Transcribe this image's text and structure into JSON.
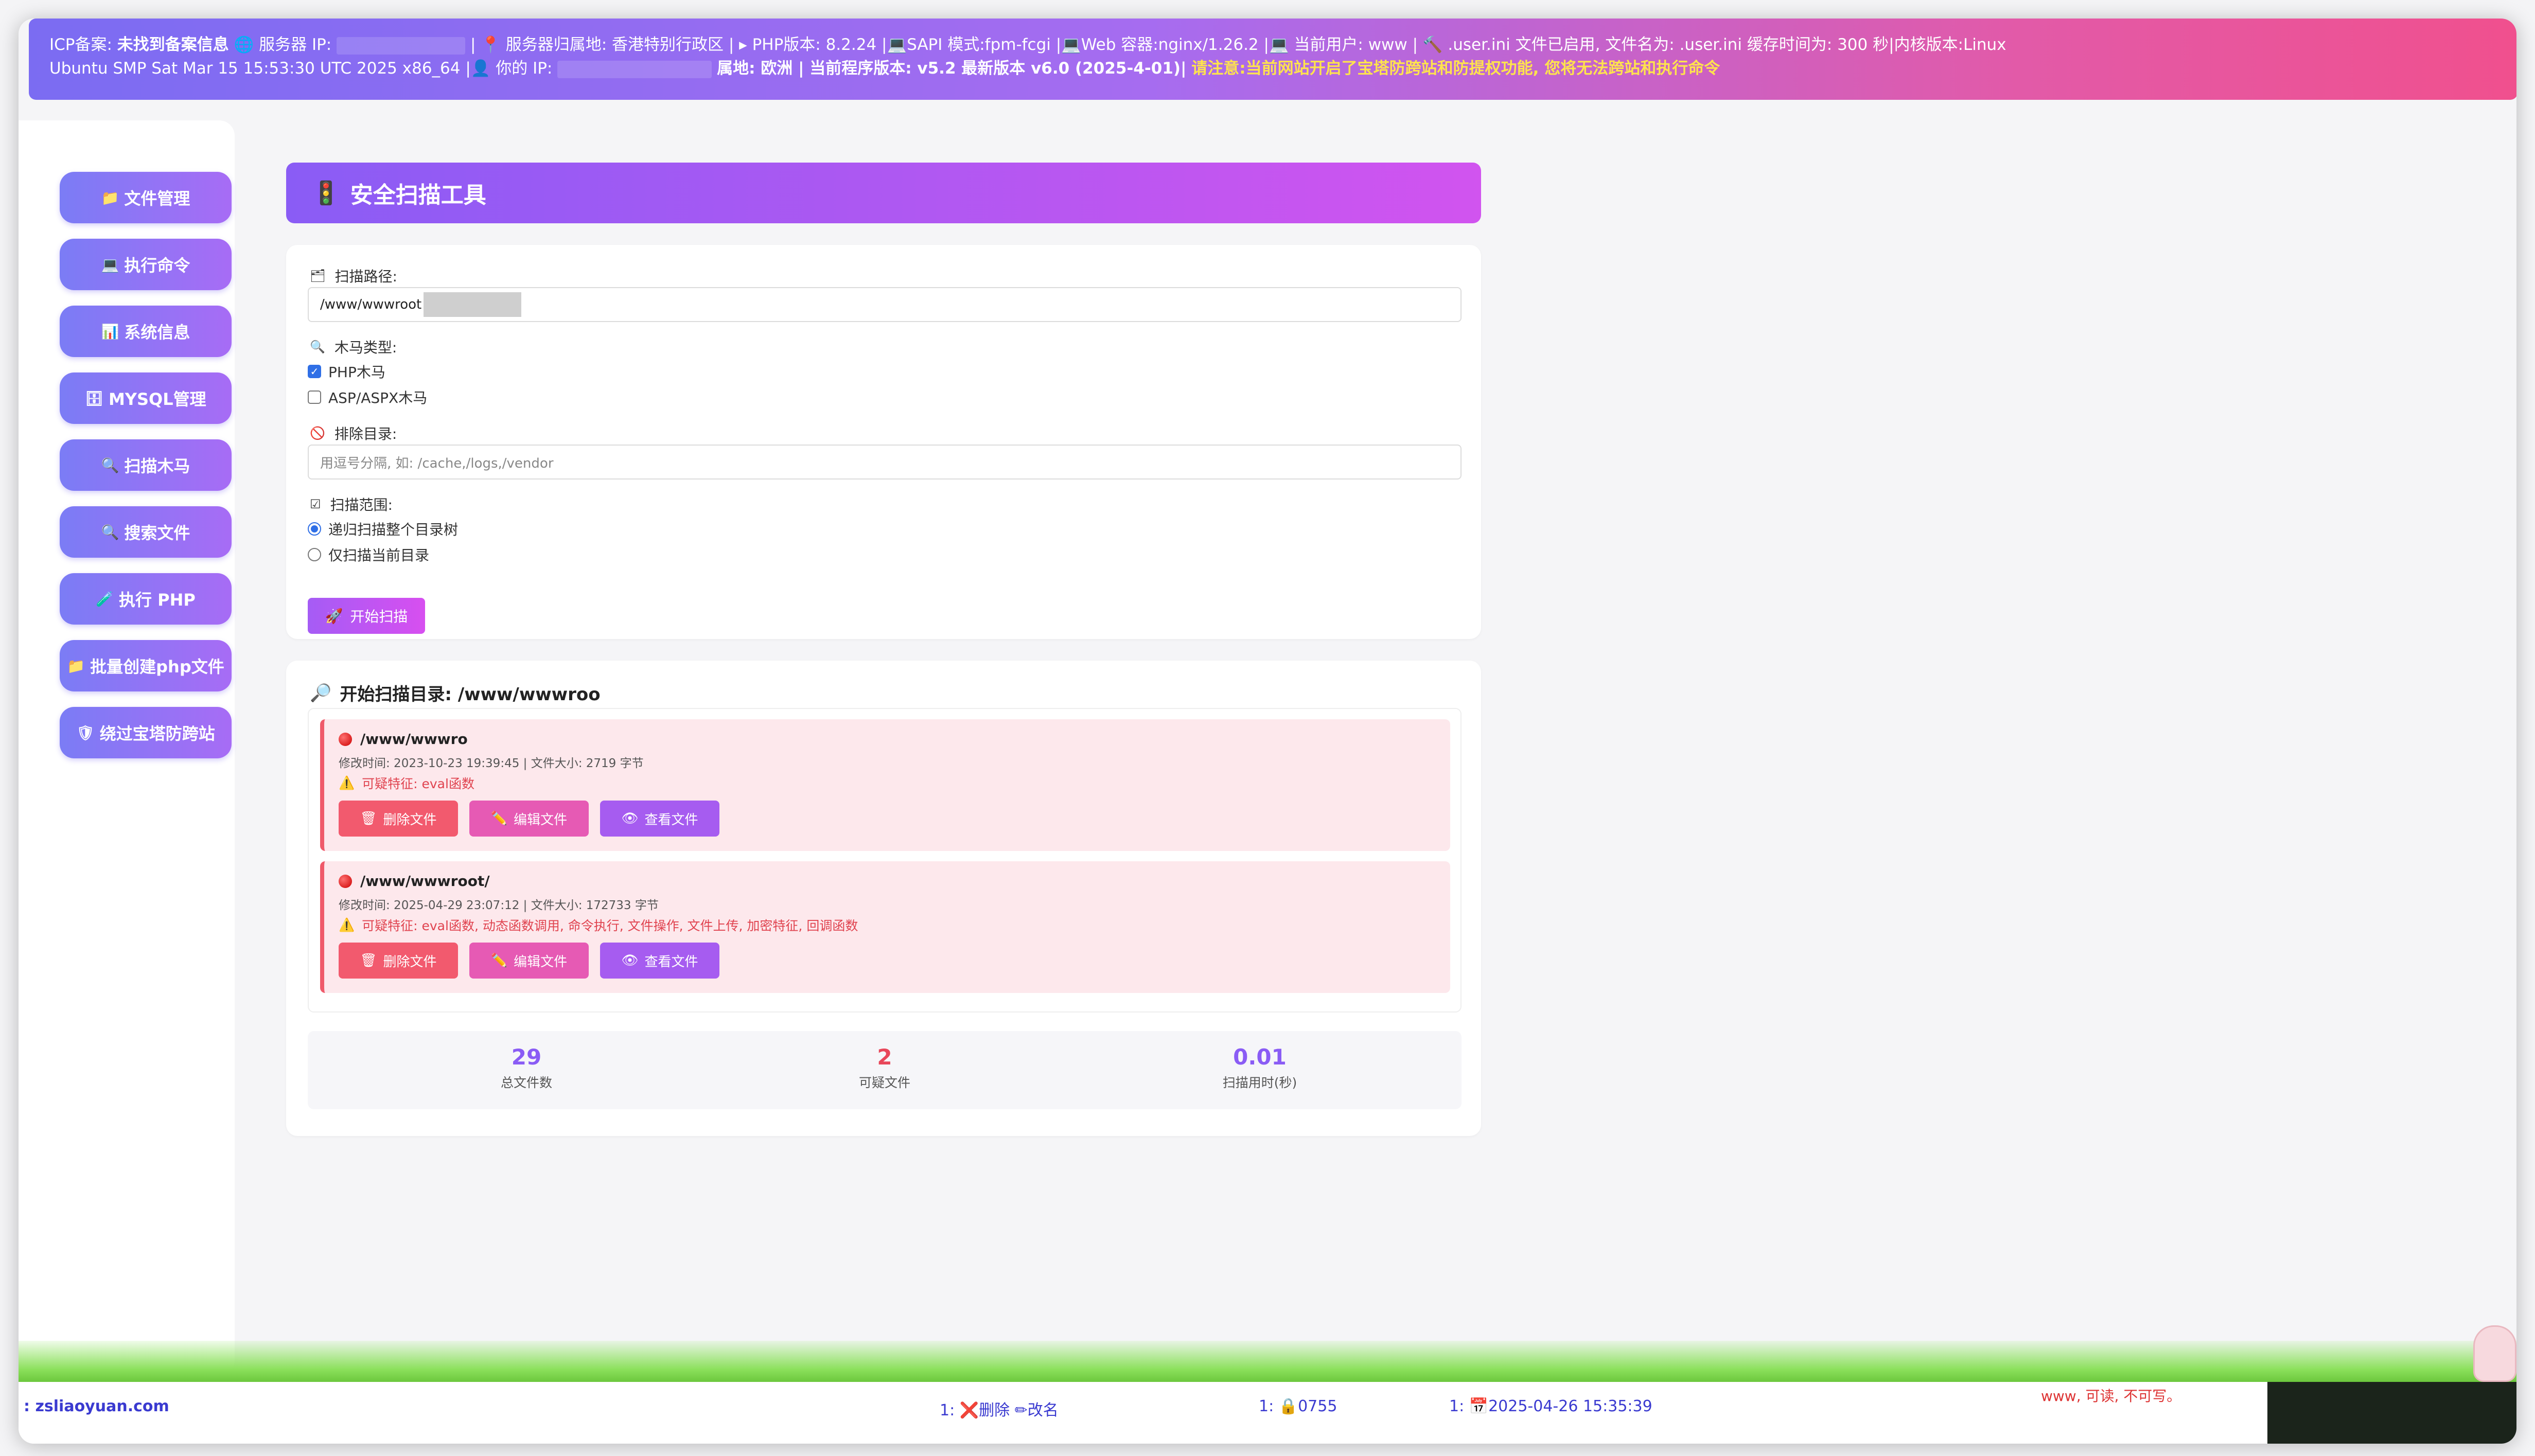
{
  "topbar": {
    "line1_a": "ICP备案:",
    "line1_b": "未找到备案信息",
    "line1_c": "🌐 服务器 IP:",
    "line1_d": "| 📍 服务器归属地: 香港特别行政区 | ▸ PHP版本: 8.2.24 |💻SAPI 模式:fpm-fcgi |💻Web 容器:nginx/1.26.2 |💻 当前用户: www | 🔨 .user.ini 文件已启用, 文件名为: .user.ini 缓存时间为: 300 秒|内核版本:Linux",
    "line2_a": "Ubuntu SMP Sat Mar 15 15:53:30 UTC 2025 x86_64 |👤 你的 IP:",
    "line2_b": "属地: 欧洲 | 当前程序版本: v5.2 最新版本 v6.0 (2025-4-01)|",
    "line2_c": "请注意:当前网站开启了宝塔防跨站和防提权功能, 您将无法跨站和执行命令"
  },
  "sidebar": {
    "items": [
      {
        "icon": "📁",
        "label": "文件管理"
      },
      {
        "icon": "💻",
        "label": "执行命令"
      },
      {
        "icon": "📊",
        "label": "系统信息"
      },
      {
        "icon": "🗄",
        "label": "MYSQL管理"
      },
      {
        "icon": "🔍",
        "label": "扫描木马"
      },
      {
        "icon": "🔍",
        "label": "搜索文件"
      },
      {
        "icon": "🧪",
        "label": "执行 PHP"
      },
      {
        "icon": "📁",
        "label": "批量创建php文件"
      },
      {
        "icon": "🛡",
        "label": "绕过宝塔防跨站"
      }
    ]
  },
  "main": {
    "title_icon": "🚦",
    "title": "安全扫描工具",
    "form": {
      "path_label": "扫描路径:",
      "path_value": "/www/wwwroot",
      "type_label": "木马类型:",
      "type_php": "PHP木马",
      "type_asp": "ASP/ASPX木马",
      "exclude_label": "排除目录:",
      "exclude_placeholder": "用逗号分隔, 如: /cache,/logs,/vendor",
      "scope_label": "扫描范围:",
      "scope_recursive": "递归扫描整个目录树",
      "scope_current": "仅扫描当前目录",
      "start_label": "开始扫描"
    },
    "results": {
      "title": "开始扫描目录: /www/wwwroo",
      "entries": [
        {
          "path": "/www/wwwro",
          "meta": "修改时间: 2023-10-23 19:39:45 | 文件大小: 2719 字节",
          "feature": "可疑特征: eval函数"
        },
        {
          "path": "/www/wwwroot/",
          "meta": "修改时间: 2025-04-29 23:07:12 | 文件大小: 172733 字节",
          "feature": "可疑特征: eval函数, 动态函数调用, 命令执行, 文件操作, 文件上传, 加密特征, 回调函数"
        }
      ],
      "btn_delete": "删除文件",
      "btn_edit": "编辑文件",
      "btn_view": "查看文件"
    },
    "stats": {
      "total_num": "29",
      "total_label": "总文件数",
      "suspicious_num": "2",
      "suspicious_label": "可疑文件",
      "time_num": "0.01",
      "time_label": "扫描用时(秒)"
    }
  },
  "footer": {
    "site": ": zsliaoyuan.com",
    "actions": "1: ❌删除  ✏改名",
    "perm": "1: 🔒0755",
    "date": "1: 📅2025-04-26 15:35:39",
    "owner": "www, 可读, 不可写。"
  }
}
